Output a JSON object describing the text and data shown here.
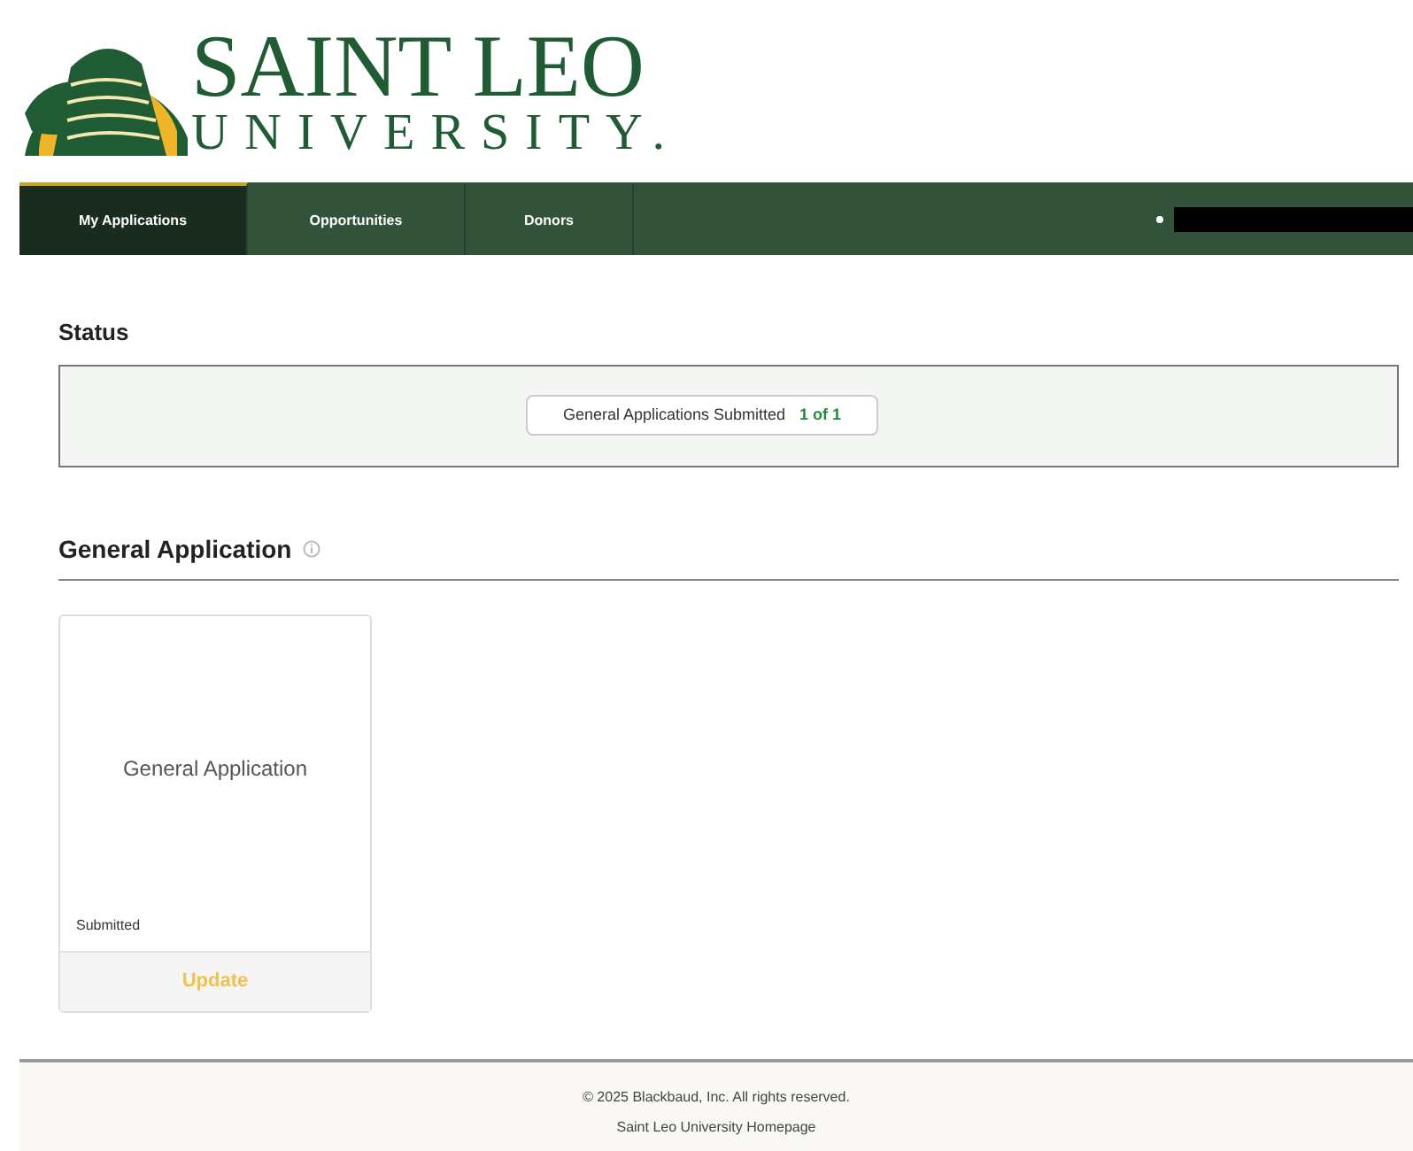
{
  "logo": {
    "line_1": "SAINT LEO",
    "line_2": "UNIVERSITY."
  },
  "nav": {
    "tabs": [
      {
        "label": "My Applications",
        "selected": true
      },
      {
        "label": "Opportunities",
        "selected": false
      },
      {
        "label": "Donors",
        "selected": false
      }
    ]
  },
  "status": {
    "heading": "Status",
    "summary_label": "General Applications Submitted",
    "summary_count": "1 of 1"
  },
  "section": {
    "heading": "General Application"
  },
  "cards": [
    {
      "title": "General Application",
      "status": "Submitted",
      "action": "Update"
    }
  ],
  "footer": {
    "copyright": "© 2025 Blackbaud, Inc. All rights reserved.",
    "link": "Saint Leo University Homepage"
  }
}
